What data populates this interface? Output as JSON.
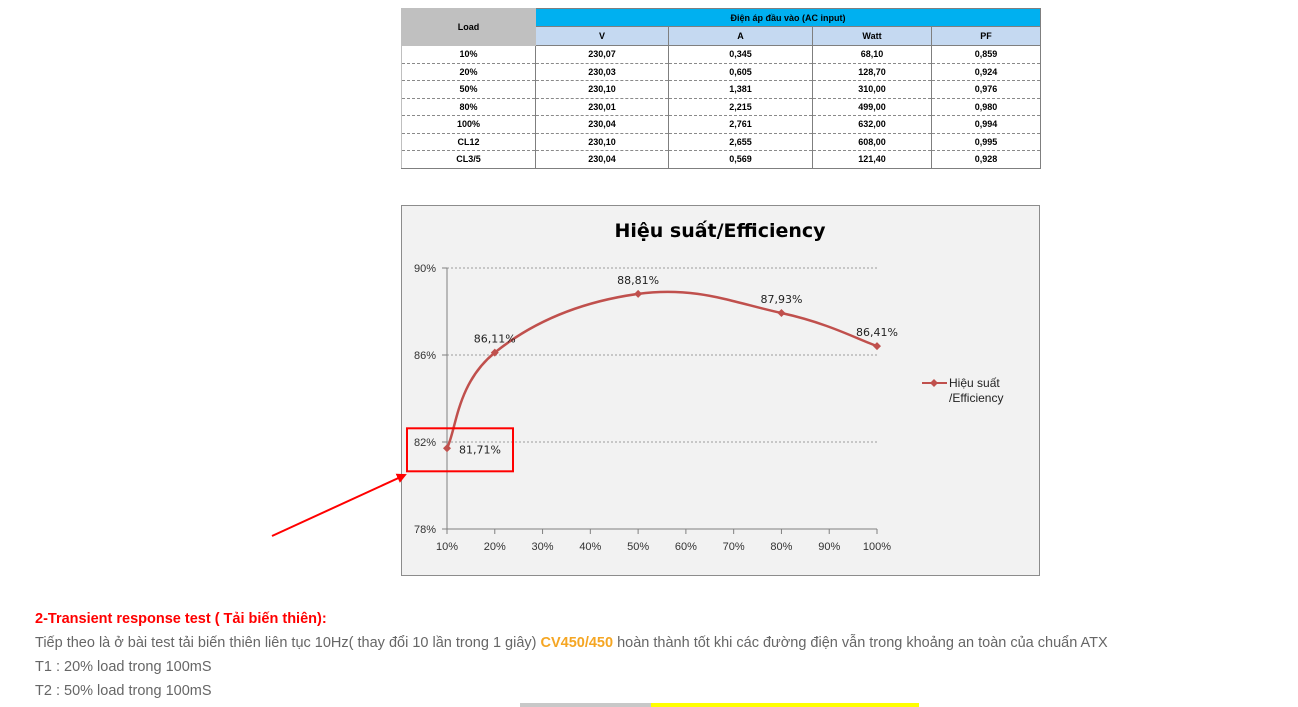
{
  "table": {
    "load_header": "Load",
    "group_header": "Điện áp đầu vào (AC input)",
    "columns": [
      "V",
      "A",
      "Watt",
      "PF"
    ],
    "rows": [
      {
        "load": "10%",
        "v": "230,07",
        "a": "0,345",
        "watt": "68,10",
        "pf": "0,859"
      },
      {
        "load": "20%",
        "v": "230,03",
        "a": "0,605",
        "watt": "128,70",
        "pf": "0,924"
      },
      {
        "load": "50%",
        "v": "230,10",
        "a": "1,381",
        "watt": "310,00",
        "pf": "0,976"
      },
      {
        "load": "80%",
        "v": "230,01",
        "a": "2,215",
        "watt": "499,00",
        "pf": "0,980"
      },
      {
        "load": "100%",
        "v": "230,04",
        "a": "2,761",
        "watt": "632,00",
        "pf": "0,994"
      },
      {
        "load": "CL12",
        "v": "230,10",
        "a": "2,655",
        "watt": "608,00",
        "pf": "0,995"
      },
      {
        "load": "CL3/5",
        "v": "230,04",
        "a": "0,569",
        "watt": "121,40",
        "pf": "0,928"
      }
    ],
    "colors": {
      "load_header_bg": "#c0c0c0",
      "group_header_bg": "#00b0f0",
      "sub_header_bg": "#c5d9f1"
    }
  },
  "chart_data": {
    "type": "line",
    "title": "Hiệu suất/Efficiency",
    "x": [
      10,
      20,
      50,
      80,
      100
    ],
    "x_ticks": [
      "10%",
      "20%",
      "30%",
      "40%",
      "50%",
      "60%",
      "70%",
      "80%",
      "90%",
      "100%"
    ],
    "y_ticks": [
      "78%",
      "82%",
      "86%",
      "90%"
    ],
    "xlim": [
      10,
      100
    ],
    "ylim": [
      78,
      90
    ],
    "grid": true,
    "legend_position": "right",
    "series": [
      {
        "name": "Hiệu suất /Efficiency",
        "legend_lines": [
          "Hiệu suất",
          "/Efficiency"
        ],
        "values": [
          81.71,
          86.11,
          88.81,
          87.93,
          86.41
        ],
        "labels": [
          "81,71%",
          "86,11%",
          "88,81%",
          "87,93%",
          "86,41%"
        ],
        "color": "#c0504d"
      }
    ],
    "highlight": {
      "point": "81,71%",
      "color": "#ff0000"
    }
  },
  "article": {
    "heading": "2-Transient response test ( Tải biến thiên):",
    "para_before": "Tiếp theo là ở bài test tải biến thiên liên tục 10Hz( thay đổi 10 lần trong 1 giây) ",
    "product": "CV450/450",
    "para_after": " hoàn thành tốt khi các đường điện vẫn trong khoảng an toàn của chuẩn ATX",
    "t1": "T1 : 20% load trong 100mS",
    "t2": "T2 : 50% load trong 100mS",
    "colors": {
      "heading": "#ff0000",
      "product": "#f5a623",
      "body": "#666666"
    }
  }
}
